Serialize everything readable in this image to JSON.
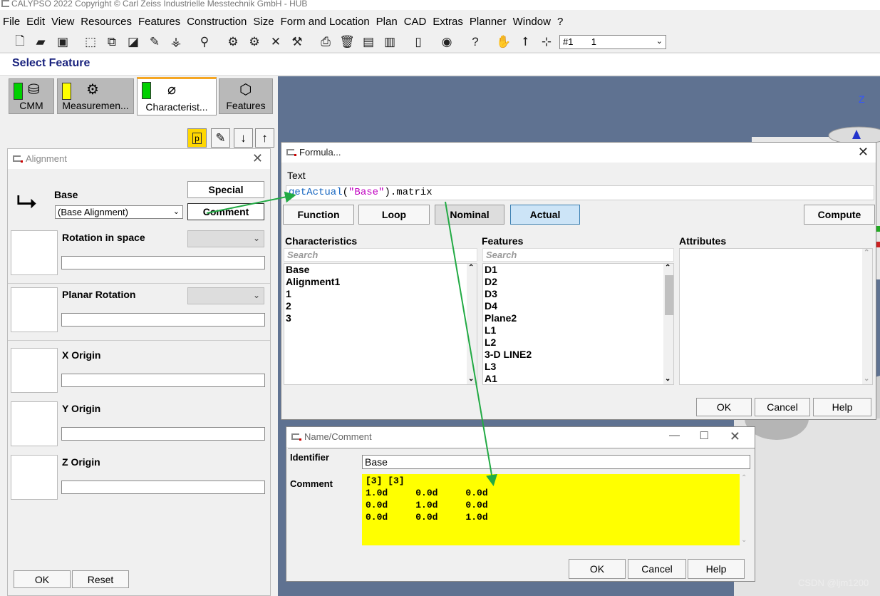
{
  "app": {
    "title": "CALYPSO 2022 Copyright © Carl Zeiss Industrielle Messtechnik GmbH - HUB"
  },
  "menu": [
    "File",
    "Edit",
    "View",
    "Resources",
    "Features",
    "Construction",
    "Size",
    "Form and Location",
    "Plan",
    "CAD",
    "Extras",
    "Planner",
    "Window",
    "?"
  ],
  "toolbar": {
    "combo_value": "#1       1"
  },
  "select_feature": "Select Feature",
  "tabs": [
    {
      "label": "CMM",
      "status": "#00d000"
    },
    {
      "label": "Measuremen...",
      "status": "#ffff00"
    },
    {
      "label": "Characterist...",
      "status": "#00d000"
    },
    {
      "label": "Features"
    }
  ],
  "alignment": {
    "title": "Alignment",
    "base_label": "Base",
    "base_value": "(Base Alignment)",
    "special_btn": "Special",
    "comment_btn": "Comment",
    "rotation_label": "Rotation in space",
    "planar_label": "Planar Rotation",
    "x_label": "X Origin",
    "y_label": "Y Origin",
    "z_label": "Z Origin",
    "ok_btn": "OK",
    "reset_btn": "Reset"
  },
  "formula": {
    "title": "Formula...",
    "text_label": "Text",
    "text_value": {
      "fn": "getActual",
      "paren_open": "(",
      "arg": "\"Base\"",
      "rest": ").matrix"
    },
    "buttons": [
      "Function",
      "Loop",
      "Nominal",
      "Actual"
    ],
    "compute_btn": "Compute",
    "char_header": "Characteristics",
    "feat_header": "Features",
    "attr_header": "Attributes",
    "search_placeholder": "Search",
    "characteristics": [
      "Base",
      "Alignment1",
      "1",
      "2",
      "3"
    ],
    "features": [
      "D1",
      "D2",
      "D3",
      "D4",
      "Plane2",
      "L1",
      "L2",
      "3-D LINE2",
      "L3",
      "A1"
    ],
    "ok_btn": "OK",
    "cancel_btn": "Cancel",
    "help_btn": "Help"
  },
  "namecomment": {
    "title": "Name/Comment",
    "identifier_label": "Identifier",
    "identifier_value": "Base",
    "comment_label": "Comment",
    "comment_lines": [
      "[3] [3]",
      "1.0d     0.0d     0.0d",
      "0.0d     1.0d     0.0d",
      "0.0d     0.0d     1.0d"
    ],
    "ok_btn": "OK",
    "cancel_btn": "Cancel",
    "help_btn": "Help"
  },
  "viewport": {
    "axis_label": "Z"
  },
  "watermark": "CSDN @ljm1200",
  "colors": {
    "accent": "#1a237e",
    "highlight": "#ffff00",
    "actual_btn": "#cce4f7",
    "arrow": "#22aa44"
  }
}
